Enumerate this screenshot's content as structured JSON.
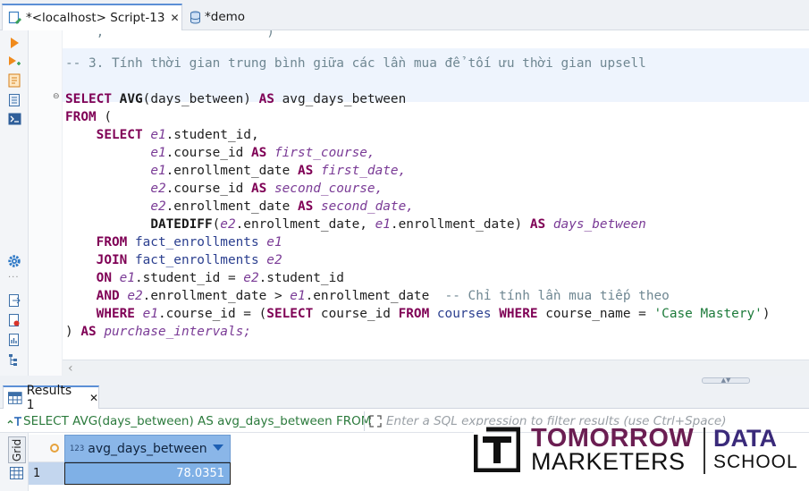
{
  "tabs": [
    {
      "label": "*<localhost> Script-13",
      "active": true
    },
    {
      "label": "*demo",
      "active": false
    }
  ],
  "editor": {
    "lines": {
      "comment": "-- 3. Tính thời gian trung bình giữa các lần mua để tối ưu thời gian upsell",
      "select_kw": "SELECT",
      "avg_fn": "AVG",
      "avg_arg": "(days_between)",
      "as_kw": "AS",
      "avg_alias": "avg_days_between",
      "from_kw": "FROM",
      "paren_open": "(",
      "inner_select_kw": "SELECT",
      "e1": "e1",
      "e2": "e2",
      "student_id_col": ".student_id,",
      "course_id_col": ".course_id",
      "enrollment_date_col": ".enrollment_date",
      "first_course": "first_course,",
      "first_date": "first_date,",
      "second_course": "second_course,",
      "second_date": "second_date,",
      "datediff_fn": "DATEDIFF",
      "datediff_args_a": "(",
      "datediff_args_b": ".enrollment_date, ",
      "datediff_args_c": ".enrollment_date)",
      "days_between": "days_between",
      "inner_from_kw": "FROM",
      "join_kw": "JOIN",
      "table": "fact_enrollments",
      "on_kw": "ON",
      "on_a": ".student_id = ",
      "on_b": ".student_id",
      "and_kw": "AND",
      "and_a": ".enrollment_date > ",
      "and_b": ".enrollment_date  ",
      "and_comment": "-- Chỉ tính lần mua tiếp theo",
      "where_kw": "WHERE",
      "where_a": ".course_id = (",
      "sub_select_kw": "SELECT",
      "sub_col": " course_id ",
      "sub_from_kw": "FROM",
      "sub_table": " courses ",
      "sub_where_kw": "WHERE",
      "sub_cond": " course_name = ",
      "sub_value": "'Case Mastery'",
      "sub_close": ")",
      "close_paren": ") ",
      "close_as_kw": "AS",
      "close_alias": "purchase_intervals;"
    }
  },
  "results": {
    "tab_label": "Results 1",
    "query_text": "SELECT AVG(days_between) AS avg_days_between FROM",
    "filter_placeholder": "Enter a SQL expression to filter results (use Ctrl+Space)",
    "side_label": "Grid",
    "columns": [
      {
        "type_badge": "123",
        "name": "avg_days_between"
      }
    ],
    "rows": [
      {
        "num": "1",
        "value": "78.0351"
      }
    ]
  },
  "watermark": {
    "line1": "TOMORROW",
    "line2": "MARKETERS",
    "line3": "DATA",
    "line4": "SCHOOL"
  },
  "colors": {
    "keyword": "#7f0055",
    "alias": "#7a3b96",
    "comment": "#6f8792",
    "string": "#1c7a3a",
    "selected_cell": "#7fb0e6",
    "column_header": "#8ab6e8"
  }
}
